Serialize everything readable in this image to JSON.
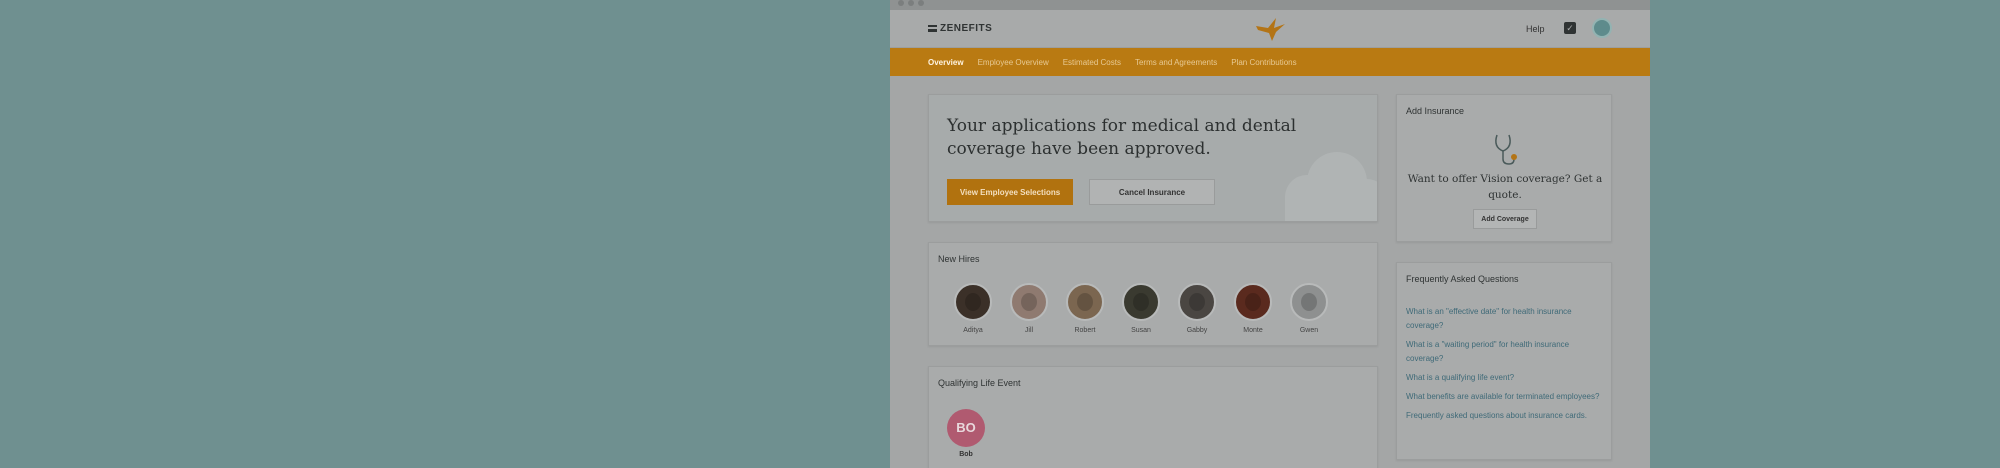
{
  "header": {
    "brand": "ZENEFITS",
    "help": "Help"
  },
  "nav": {
    "tabs": [
      {
        "label": "Overview",
        "active": true
      },
      {
        "label": "Employee Overview",
        "active": false
      },
      {
        "label": "Estimated Costs",
        "active": false
      },
      {
        "label": "Terms and Agreements",
        "active": false
      },
      {
        "label": "Plan Contributions",
        "active": false
      }
    ]
  },
  "hero": {
    "message": "Your applications for medical and dental coverage have been approved.",
    "primary_button": "View Employee Selections",
    "secondary_button": "Cancel Insurance"
  },
  "new_hires": {
    "title": "New Hires",
    "people": [
      {
        "name": "Aditya",
        "color": "#3b3028"
      },
      {
        "name": "Jill",
        "color": "#8f7a70"
      },
      {
        "name": "Robert",
        "color": "#7b6650"
      },
      {
        "name": "Susan",
        "color": "#3a3a30"
      },
      {
        "name": "Gabby",
        "color": "#4a4642"
      },
      {
        "name": "Monte",
        "color": "#5a2a1e"
      },
      {
        "name": "Gwen",
        "color": "#8e9090"
      }
    ]
  },
  "qualifying_life_event": {
    "title": "Qualifying Life Event",
    "initials": "BO",
    "name": "Bob"
  },
  "add_insurance": {
    "title": "Add Insurance",
    "prompt": "Want to offer Vision coverage? Get a quote.",
    "button": "Add Coverage"
  },
  "faq": {
    "title": "Frequently Asked Questions",
    "items": [
      "What is an \"effective date\" for health insurance coverage?",
      "What is a \"waiting period\" for health insurance coverage?",
      "What is a qualifying life event?",
      "What benefits are available for terminated employees?",
      "Frequently asked questions about insurance cards."
    ]
  },
  "colors": {
    "background": "#6f9090",
    "accent_orange": "#b97a12",
    "link": "#3f6a78"
  }
}
